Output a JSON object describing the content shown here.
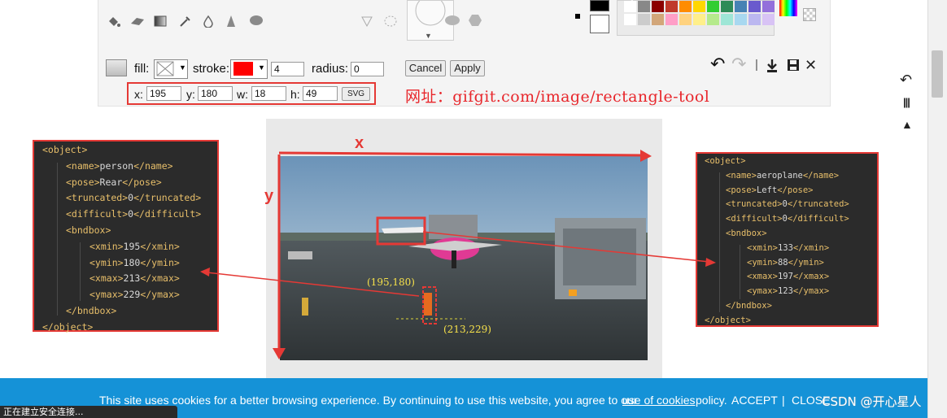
{
  "toolbar": {
    "fill_label": "fill:",
    "stroke_label": "stroke:",
    "stroke_width": "4",
    "radius_label": "radius:",
    "radius_value": "0",
    "cancel_label": "Cancel",
    "apply_label": "Apply",
    "x_label": "x:",
    "x_value": "195",
    "y_label": "y:",
    "y_value": "180",
    "w_label": "w:",
    "w_value": "18",
    "h_label": "h:",
    "h_value": "49",
    "svg_label": "SVG",
    "stroke_color": "#ff0000",
    "separator": "|",
    "glyphs": {
      "caret": "▼",
      "undo": "↶",
      "redo": "↷",
      "download": "⤓",
      "save": "🖫",
      "close": "✕",
      "collapse": "▼",
      "check": "✔"
    },
    "palette_row1": [
      "#ffffff",
      "#888888",
      "#8b0000",
      "#c0392b",
      "#ff8c00",
      "#ffd700",
      "#32cd32",
      "#2e8b57",
      "#4682b4",
      "#6a5acd",
      "#9370db"
    ],
    "palette_row2": [
      "#ffffff",
      "#cccccc",
      "#d2a679",
      "#ff9ec7",
      "#ffd27f",
      "#ffef8a",
      "#b5ea8c",
      "#9ee6d6",
      "#a8d8f0",
      "#bbb7f0",
      "#d8c3f5"
    ]
  },
  "url_note": "网址：gifgit.com/image/rectangle-tool",
  "left_xml": {
    "lines": [
      "<object>",
      "<name>",
      "person",
      "</name>",
      "<pose>",
      "Rear",
      "</pose>",
      "<truncated>",
      "0",
      "</truncated>",
      "<difficult>",
      "0",
      "</difficult>",
      "<bndbox>",
      "<xmin>",
      "195",
      "</xmin>",
      "<ymin>",
      "180",
      "</ymin>",
      "<xmax>",
      "213",
      "</xmax>",
      "<ymax>",
      "229",
      "</ymax>",
      "</bndbox>",
      "</object>"
    ]
  },
  "right_xml": {
    "lines": [
      "<object>",
      "<name>",
      "aeroplane",
      "</name>",
      "<pose>",
      "Left",
      "</pose>",
      "<truncated>",
      "0",
      "</truncated>",
      "<difficult>",
      "0",
      "</difficult>",
      "<bndbox>",
      "<xmin>",
      "133",
      "</xmin>",
      "<ymin>",
      "88",
      "</ymin>",
      "<xmax>",
      "197",
      "</xmax>",
      "<ymax>",
      "123",
      "</ymax>",
      "</bndbox>",
      "</object>"
    ]
  },
  "annotations": {
    "x_axis_label": "x",
    "y_axis_label": "y",
    "point_a": "(195,180)",
    "point_b": "(213,229)"
  },
  "cookie": {
    "text": "This site uses cookies for a better browsing experience. By continuing to use this website, you agree to our",
    "link": "use of cookies",
    "after": "policy.",
    "accept": "ACCEPT",
    "separator": "|",
    "close": "CLOSE"
  },
  "status_text": "正在建立安全连接...",
  "watermark": "CSDN @开心星人",
  "side_tools": {
    "undo": "↶",
    "bars": "|||",
    "tree": "▲"
  }
}
